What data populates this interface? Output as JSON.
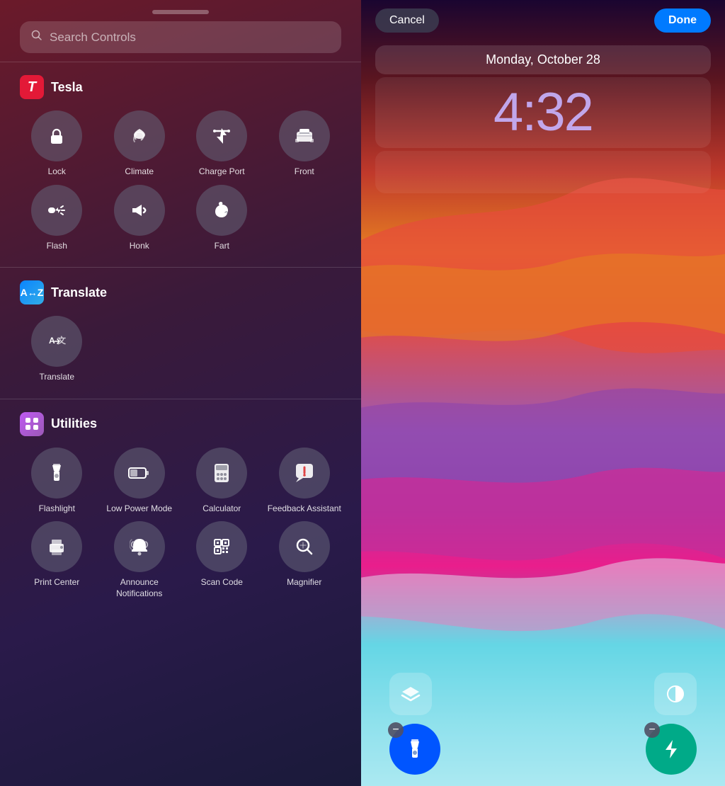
{
  "left": {
    "search": {
      "placeholder": "Search Controls"
    },
    "sections": [
      {
        "id": "tesla",
        "title": "Tesla",
        "icon_type": "tesla",
        "controls": [
          {
            "id": "lock",
            "label": "Lock",
            "icon": "🔒"
          },
          {
            "id": "climate",
            "label": "Climate",
            "icon": "💨"
          },
          {
            "id": "charge-port",
            "label": "Charge Port",
            "icon": "⚡"
          },
          {
            "id": "front",
            "label": "Front",
            "icon": "🚗"
          },
          {
            "id": "flash",
            "label": "Flash",
            "icon": "💡"
          },
          {
            "id": "honk",
            "label": "Honk",
            "icon": "📢"
          },
          {
            "id": "fart",
            "label": "Fart",
            "icon": "🌀"
          }
        ]
      },
      {
        "id": "translate",
        "title": "Translate",
        "icon_type": "translate",
        "controls": [
          {
            "id": "translate",
            "label": "Translate",
            "icon": "🌐"
          }
        ]
      },
      {
        "id": "utilities",
        "title": "Utilities",
        "icon_type": "utilities",
        "controls": [
          {
            "id": "flashlight",
            "label": "Flashlight",
            "icon": "🔦"
          },
          {
            "id": "low-power",
            "label": "Low Power Mode",
            "icon": "🔋"
          },
          {
            "id": "calculator",
            "label": "Calculator",
            "icon": "🧮"
          },
          {
            "id": "feedback",
            "label": "Feedback Assistant",
            "icon": "❗"
          },
          {
            "id": "print-center",
            "label": "Print Center",
            "icon": "🖨"
          },
          {
            "id": "announce-notif",
            "label": "Announce Notifications",
            "icon": "🔔"
          },
          {
            "id": "scan-code",
            "label": "Scan Code",
            "icon": "📷"
          },
          {
            "id": "magnifier",
            "label": "Magnifier",
            "icon": "🔍"
          }
        ]
      }
    ]
  },
  "right": {
    "cancel_label": "Cancel",
    "done_label": "Done",
    "date": "Monday, October 28",
    "time": "4:32",
    "bottom_widgets": [
      {
        "id": "layers",
        "icon": "layers"
      },
      {
        "id": "contrast",
        "icon": "contrast"
      }
    ],
    "bottom_controls": [
      {
        "id": "flashlight-active",
        "active": true,
        "color": "blue"
      },
      {
        "id": "charge-active",
        "active": true,
        "color": "teal"
      }
    ]
  }
}
